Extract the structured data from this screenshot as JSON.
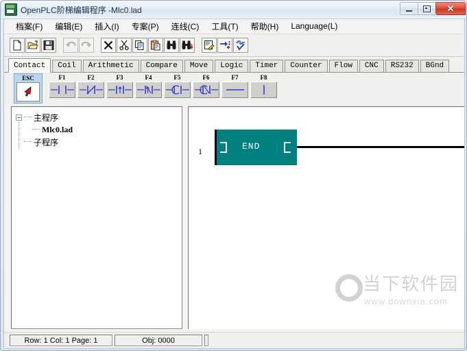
{
  "window": {
    "title": "OpenPLC阶梯编辑程序 -Mlc0.lad",
    "icon": "openplc-app-icon",
    "buttons": {
      "minimize": "minimize-button",
      "maximize": "maximize-button",
      "close": "✕"
    }
  },
  "menubar": {
    "items": [
      {
        "label": "档案(F)",
        "name": "menu-file"
      },
      {
        "label": "编辑(E)",
        "name": "menu-edit"
      },
      {
        "label": "插入(I)",
        "name": "menu-insert"
      },
      {
        "label": "专案(P)",
        "name": "menu-project"
      },
      {
        "label": "连线(C)",
        "name": "menu-connect"
      },
      {
        "label": "工具(T)",
        "name": "menu-tools"
      },
      {
        "label": "帮助(H)",
        "name": "menu-help"
      },
      {
        "label": "Language(L)",
        "name": "menu-language"
      }
    ]
  },
  "toolbar": {
    "buttons": [
      {
        "icon": "new-file-icon",
        "enabled": true
      },
      {
        "icon": "open-folder-icon",
        "enabled": true
      },
      {
        "icon": "save-disk-icon",
        "enabled": true
      },
      {
        "icon": "undo-arrow-icon",
        "enabled": false
      },
      {
        "icon": "redo-arrow-icon",
        "enabled": false
      },
      {
        "icon": "delete-x-icon",
        "enabled": true
      },
      {
        "icon": "cut-scissors-icon",
        "enabled": true
      },
      {
        "icon": "copy-pages-icon",
        "enabled": true
      },
      {
        "icon": "paste-clipboard-icon",
        "enabled": true
      },
      {
        "icon": "find-binoculars-icon",
        "enabled": true
      },
      {
        "icon": "find-replace-binoculars-icon",
        "enabled": true
      },
      {
        "icon": "edit-comment-icon",
        "enabled": true
      },
      {
        "icon": "insert-element-icon",
        "enabled": true
      },
      {
        "icon": "verify-program-icon",
        "enabled": true
      }
    ]
  },
  "tabs": {
    "active_index": 0,
    "items": [
      "Contact",
      "Coil",
      "Arithmetic",
      "Compare",
      "Move",
      "Logic",
      "Timer",
      "Counter",
      "Flow",
      "CNC",
      "RS232",
      "BGnd"
    ]
  },
  "palette": {
    "esc": {
      "label": "ESC",
      "icon": "pointer-arrow-icon",
      "selected": true
    },
    "keys": [
      {
        "label": "F1",
        "symbol": "no-contact",
        "name": "palette-f1-normally-open-contact"
      },
      {
        "label": "F2",
        "symbol": "nc-contact",
        "name": "palette-f2-normally-closed-contact"
      },
      {
        "label": "F3",
        "symbol": "rising-contact",
        "name": "palette-f3-rising-edge-contact"
      },
      {
        "label": "F4",
        "symbol": "falling-contact",
        "name": "palette-f4-falling-edge-contact"
      },
      {
        "label": "F5",
        "symbol": "compare-contact",
        "name": "palette-f5-compare-contact"
      },
      {
        "label": "F6",
        "symbol": "compare-not-contact",
        "name": "palette-f6-compare-not-contact"
      },
      {
        "label": "F7",
        "symbol": "horizontal-line",
        "name": "palette-f7-horizontal-link"
      },
      {
        "label": "F8",
        "symbol": "vertical-line",
        "name": "palette-f8-vertical-link"
      }
    ]
  },
  "tree": {
    "nodes": [
      {
        "label": "主程序",
        "type": "folder",
        "expanded": true
      },
      {
        "label": "Mlc0.lad",
        "type": "file"
      },
      {
        "label": "子程序",
        "type": "folder",
        "expanded": false
      }
    ]
  },
  "ladder": {
    "rung_number": "1",
    "end_block_label": "END",
    "end_block_color": "#008080"
  },
  "watermark": {
    "brand": "当下软件园",
    "url": "www.downxia.com"
  },
  "statusbar": {
    "position": "Row: 1  Col: 1  Page: 1",
    "object": "Obj: 0000"
  }
}
